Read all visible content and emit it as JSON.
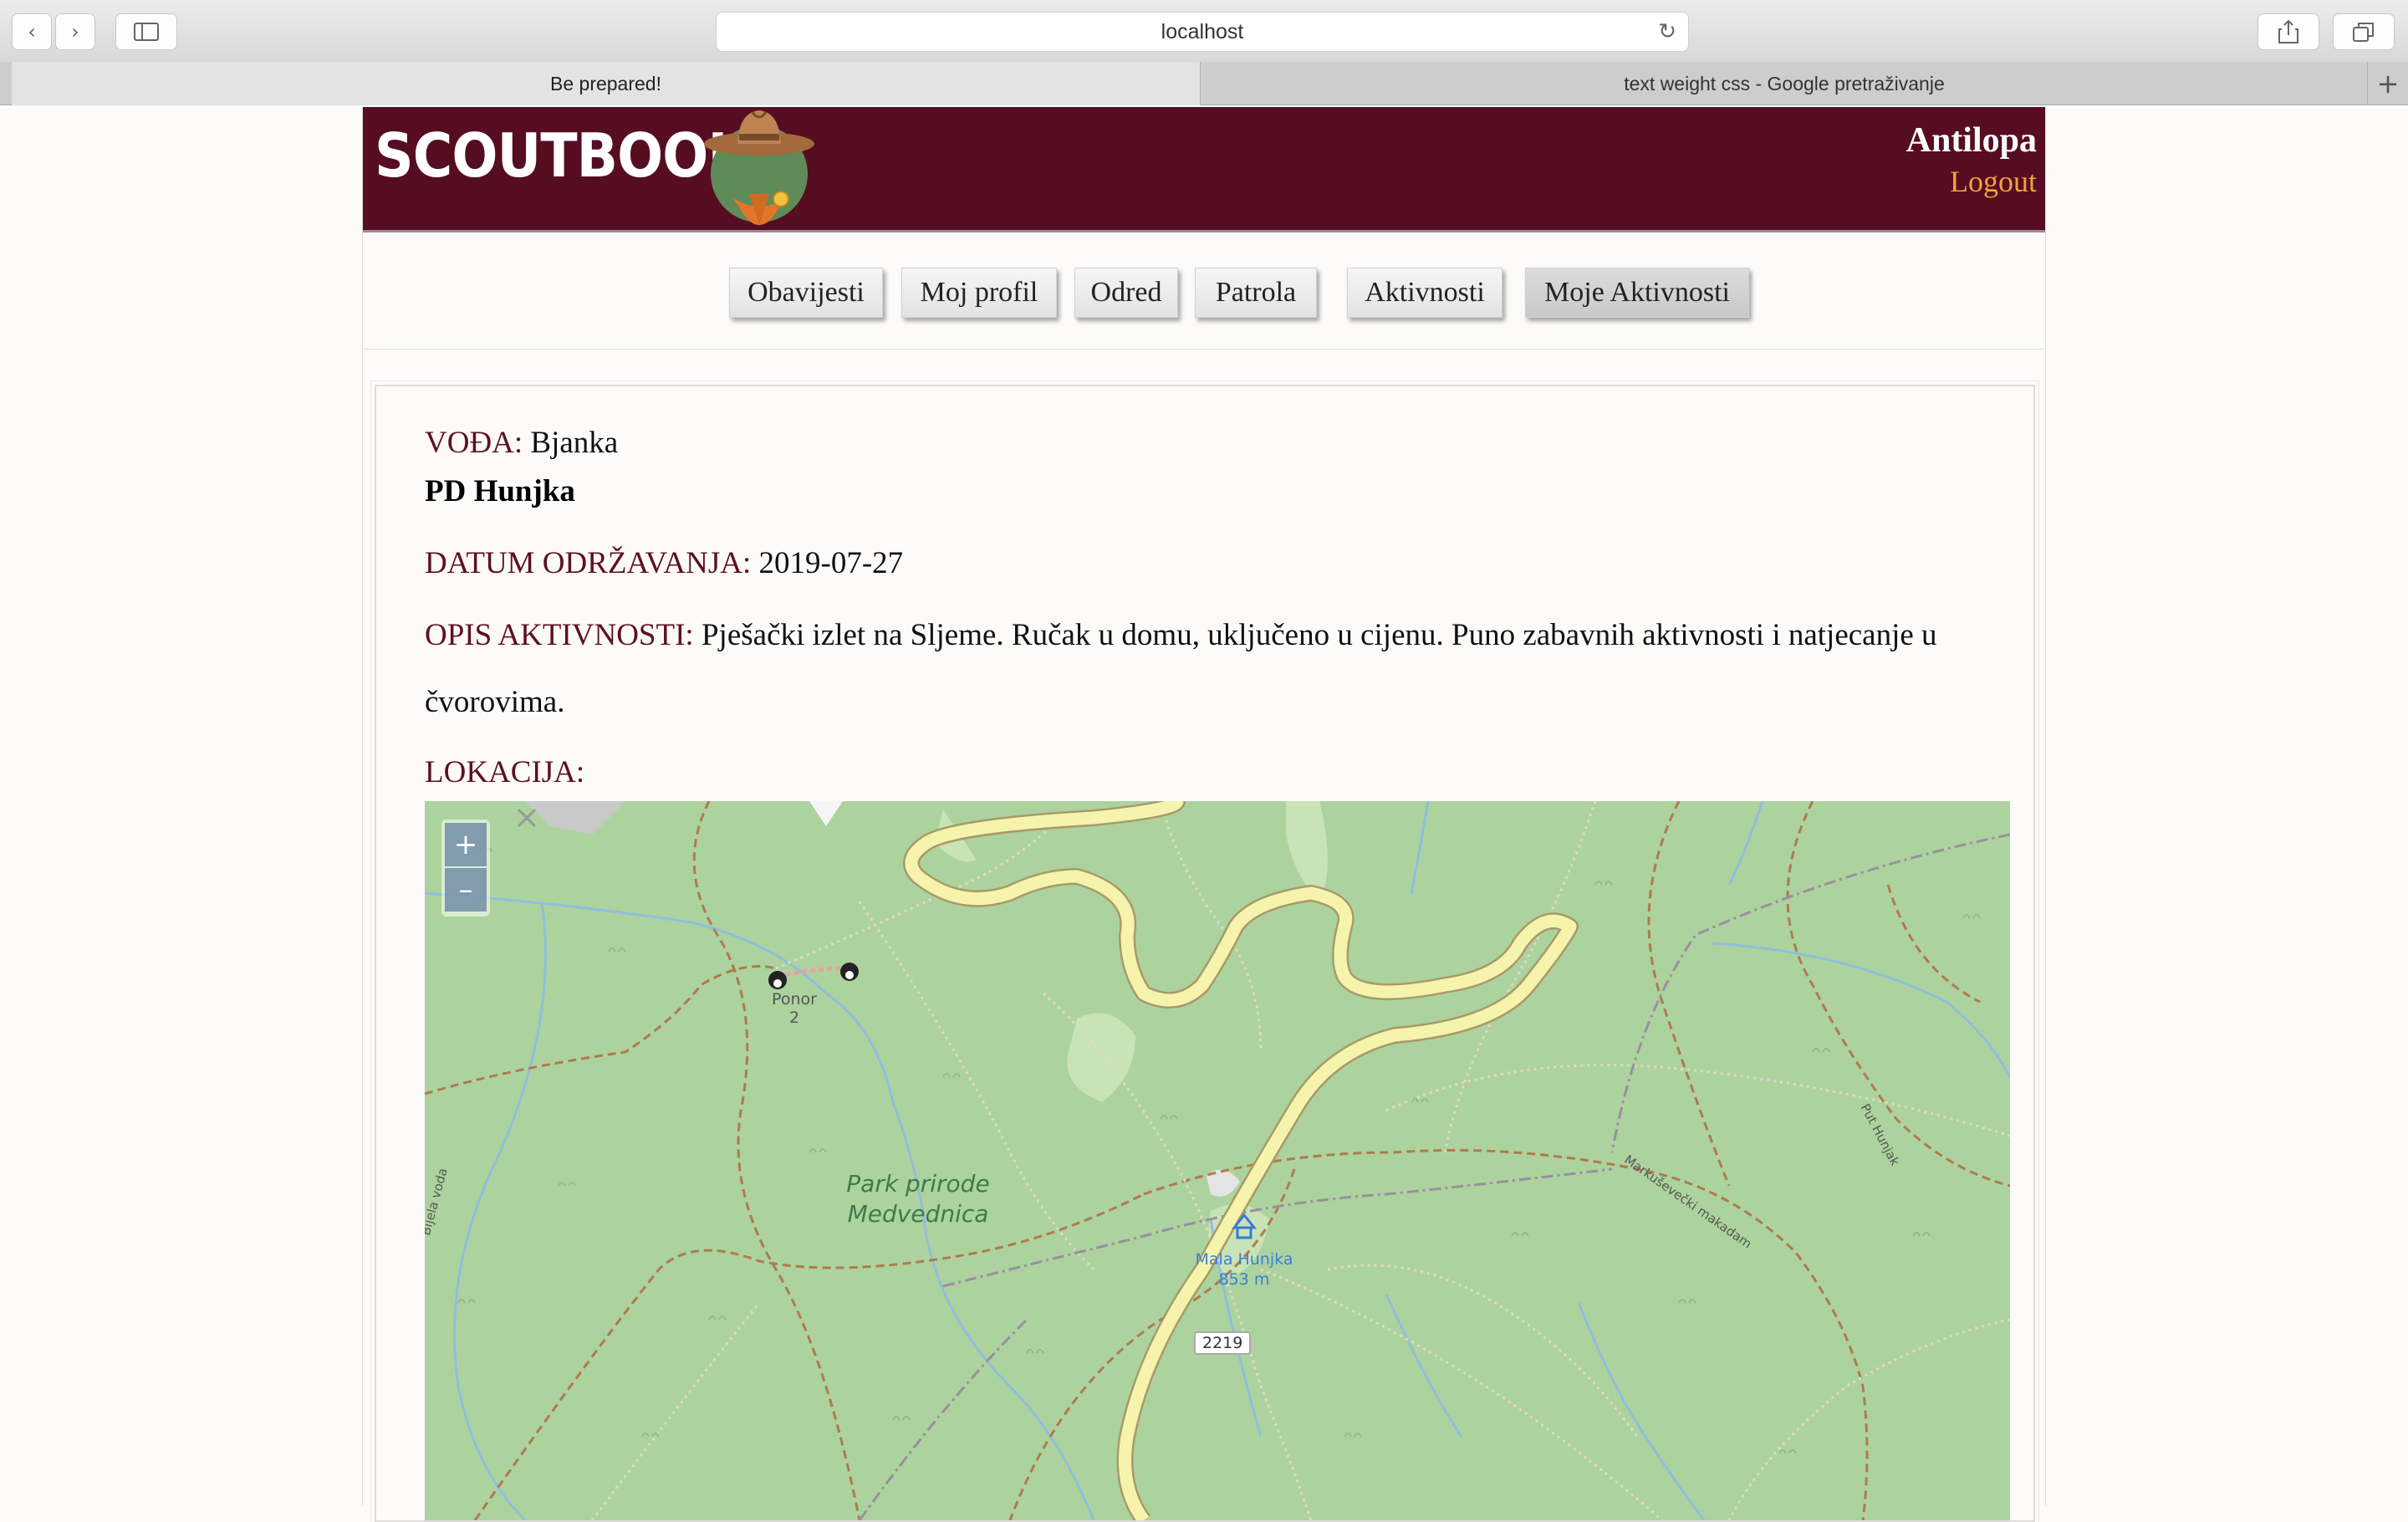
{
  "browser": {
    "url": "localhost",
    "tabs": [
      {
        "label": "Be prepared!",
        "active": true
      },
      {
        "label": "text weight css - Google pretraživanje",
        "active": false
      }
    ]
  },
  "header": {
    "brand": "SCOUTBOOK",
    "user": "Antilopa",
    "logout": "Logout",
    "colors": {
      "background": "#560d22",
      "logout": "#f2a23a"
    }
  },
  "menu": {
    "items": [
      "Obavijesti",
      "Moj profil",
      "Odred",
      "Patrola",
      "Aktivnosti",
      "Moje Aktivnosti"
    ],
    "current": "Moje Aktivnosti"
  },
  "activity": {
    "leader_label": "VOĐA:",
    "leader": "Bjanka",
    "title": "PD Hunjka",
    "date_label": "DATUM ODRŽAVANJA:",
    "date": "2019-07-27",
    "description_label": "OPIS AKTIVNOSTI:",
    "description": "Pješački izlet na Sljeme. Ručak u domu, uključeno u cijenu. Puno zabavnih aktivnosti i natjecanje u čvorovima.",
    "location_label": "LOKACIJA:"
  },
  "map": {
    "zoom_in": "+",
    "zoom_out": "–",
    "labels": {
      "cave_name": "Ponor",
      "cave_number": "2",
      "park_line1": "Park prirode",
      "park_line2": "Medvednica",
      "peak_name": "Mala Hunjka",
      "peak_elevation": "853 m",
      "road_number": "2219",
      "stream": "Bijela voda",
      "path_east": "Markuševečki makadam",
      "path_ne": "Put Hunjak"
    }
  }
}
